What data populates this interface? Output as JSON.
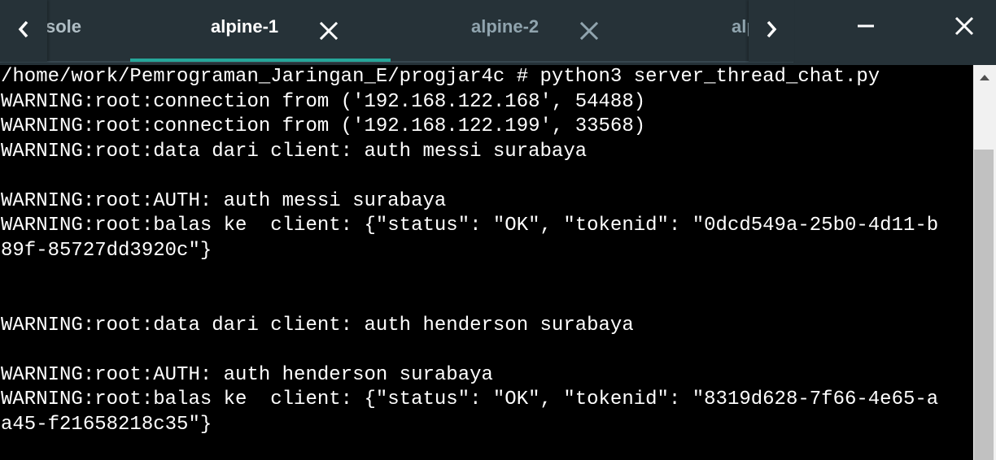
{
  "tabs": [
    {
      "label": "sole",
      "active": false
    },
    {
      "label": "alpine-1",
      "active": true
    },
    {
      "label": "alpine-2",
      "active": false
    },
    {
      "label": "alp",
      "active": false
    }
  ],
  "icons": {
    "nav_left": "chevron-left-icon",
    "nav_right": "chevron-right-icon",
    "tab_close": "close-icon",
    "minimize": "minimize-icon",
    "window_close": "close-icon",
    "scroll_up": "arrow-up-icon"
  },
  "colors": {
    "tabbar_bg": "#263238",
    "active_tab_text": "#ffffff",
    "inactive_tab_text": "#90a4ae",
    "active_tab_indicator": "#26a69a",
    "terminal_bg": "#000000",
    "terminal_text": "#ffffff"
  },
  "terminal": {
    "lines": [
      "/home/work/Pemrograman_Jaringan_E/progjar4c # python3 server_thread_chat.py",
      "WARNING:root:connection from ('192.168.122.168', 54488)",
      "WARNING:root:connection from ('192.168.122.199', 33568)",
      "WARNING:root:data dari client: auth messi surabaya",
      "",
      "WARNING:root:AUTH: auth messi surabaya",
      "WARNING:root:balas ke  client: {\"status\": \"OK\", \"tokenid\": \"0dcd549a-25b0-4d11-b",
      "89f-85727dd3920c\"}",
      "",
      "",
      "WARNING:root:data dari client: auth henderson surabaya",
      "",
      "WARNING:root:AUTH: auth henderson surabaya",
      "WARNING:root:balas ke  client: {\"status\": \"OK\", \"tokenid\": \"8319d628-7f66-4e65-a",
      "a45-f21658218c35\"}"
    ]
  }
}
